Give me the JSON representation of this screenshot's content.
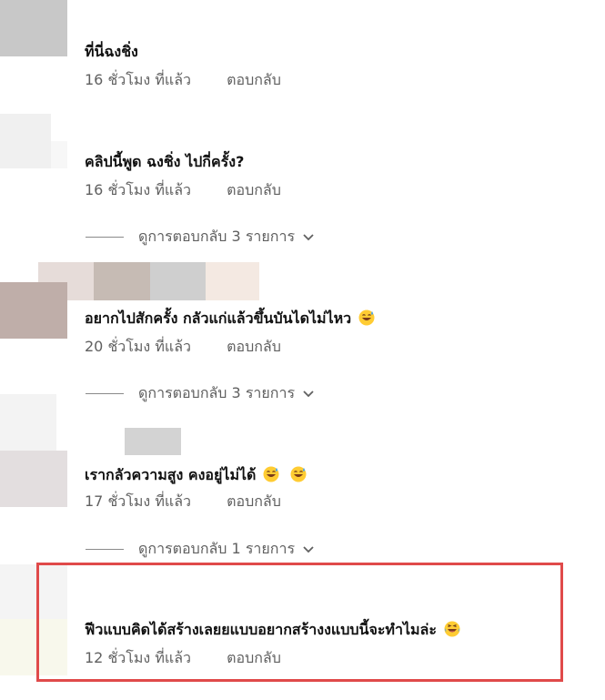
{
  "comments": [
    {
      "text": "ที่นี่ฉงชิ่ง",
      "time": "16 ชั่วโมง ที่แล้ว",
      "reply": "ตอบกลับ"
    },
    {
      "text": "คลิปนี้พูด ฉงชิ่ง ไปกี่ครั้ง?",
      "time": "16 ชั่วโมง ที่แล้ว",
      "reply": "ตอบกลับ",
      "replies": "ดูการตอบกลับ 3 รายการ"
    },
    {
      "text": "อยากไปสักครั้ง กลัวแก่แล้วขึ้นบันไดไม่ไหว",
      "time": "20 ชั่วโมง ที่แล้ว",
      "reply": "ตอบกลับ",
      "replies": "ดูการตอบกลับ 3 รายการ"
    },
    {
      "text": "เรากลัวความสูง คงอยู่ไม่ได้",
      "time": "17 ชั่วโมง ที่แล้ว",
      "reply": "ตอบกลับ",
      "replies": "ดูการตอบกลับ 1 รายการ"
    },
    {
      "text": "ฟีวแบบคิดได้สร้างเลยยแบบอยากสร้างงแบบนี้จะทำไมล่ะ",
      "time": "12 ชั่วโมง ที่แล้ว",
      "reply": "ตอบกลับ"
    }
  ],
  "icons": {
    "emoji_sweat_smile": "grinning-face-with-sweat",
    "emoji_laughing": "laughing-face",
    "chevron": "chevron-down"
  },
  "colors": {
    "highlight": "#e04a4a",
    "meta_text": "#606060"
  }
}
